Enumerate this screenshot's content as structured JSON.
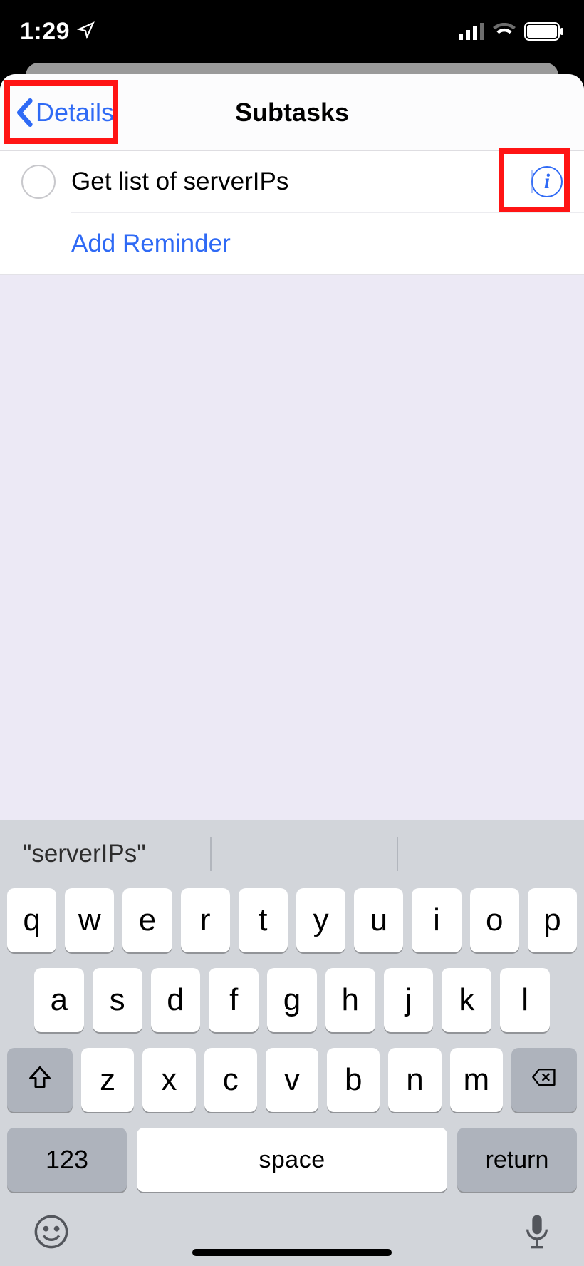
{
  "status": {
    "time": "1:29"
  },
  "nav": {
    "back_label": "Details",
    "title": "Subtasks"
  },
  "list": {
    "item0": {
      "title": "Get list of serverIPs"
    },
    "add_label": "Add Reminder"
  },
  "keyboard": {
    "predictions": {
      "p0": "\"serverIPs\"",
      "p1": "",
      "p2": ""
    },
    "row1": {
      "k0": "q",
      "k1": "w",
      "k2": "e",
      "k3": "r",
      "k4": "t",
      "k5": "y",
      "k6": "u",
      "k7": "i",
      "k8": "o",
      "k9": "p"
    },
    "row2": {
      "k0": "a",
      "k1": "s",
      "k2": "d",
      "k3": "f",
      "k4": "g",
      "k5": "h",
      "k6": "j",
      "k7": "k",
      "k8": "l"
    },
    "row3": {
      "k0": "z",
      "k1": "x",
      "k2": "c",
      "k3": "v",
      "k4": "b",
      "k5": "n",
      "k6": "m"
    },
    "row4": {
      "numbers": "123",
      "space": "space",
      "return": "return"
    }
  }
}
